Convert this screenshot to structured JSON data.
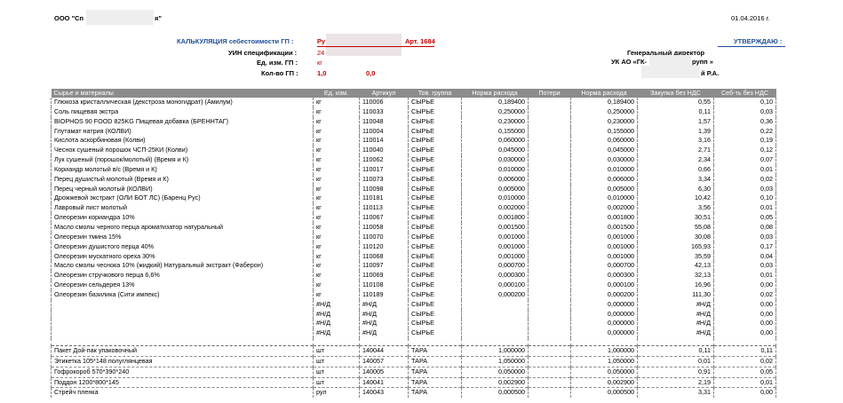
{
  "header": {
    "company": "ООО \"Сп",
    "company_end": "я\"",
    "date": "01.04.2016 г.",
    "calc_label": "КАЛЬКУЛЯЦИЯ себестоимости ГП :",
    "calc_value": "Ру",
    "art": "Арт. 1684",
    "approve": "УТВЕРЖДАЮ :",
    "uin_label": "УИН спецификации :",
    "uin_value": "24",
    "director": "Генеральный директор",
    "unit_label": "Ед. изм. ГП :",
    "unit_value": "кг",
    "uk": "УК АО «ГК-",
    "uk_end": "рупп »",
    "qty_label": "Кол-во ГП :",
    "qty_value": "1,0",
    "qty_value2": "0,0",
    "signer": "й Р.А."
  },
  "table": {
    "columns": [
      "Сырье и материалы",
      "Ед. изм.",
      "Артикул",
      "Тов. группа",
      "Норма расхода",
      "Потери",
      "Норма расхода",
      "Закупка без НДС",
      "Себ-ть без НДС"
    ],
    "rows": [
      [
        "Глюкоза кристаллическая (декстроза моногидрат) (Амилум)",
        "кг",
        "110006",
        "СЫРЬЕ",
        "0,189400",
        "",
        "0,189400",
        "0,55",
        "0,10"
      ],
      [
        "Соль пищевая экстра",
        "кг",
        "110033",
        "СЫРЬЕ",
        "0,250000",
        "",
        "0,250000",
        "0,11",
        "0,03"
      ],
      [
        "BIOPHOS 90 FOOD 825KG Пищевая добавка (БРЕННТАГ)",
        "кг",
        "110048",
        "СЫРЬЕ",
        "0,230000",
        "",
        "0,230000",
        "1,57",
        "0,36"
      ],
      [
        "Глутамат натрия (КОЛВИ)",
        "кг",
        "110004",
        "СЫРЬЕ",
        "0,155000",
        "",
        "0,155000",
        "1,39",
        "0,22"
      ],
      [
        "Кислота аскорбиновая (Колви)",
        "кг",
        "110014",
        "СЫРЬЕ",
        "0,060000",
        "",
        "0,060000",
        "3,16",
        "0,19"
      ],
      [
        "Чеснок сушеный порошок ЧСП-25КИ (Колви)",
        "кг",
        "110040",
        "СЫРЬЕ",
        "0,045000",
        "",
        "0,045000",
        "2,71",
        "0,12"
      ],
      [
        "Лук сушеный (порошок/молотый) (Время и К)",
        "кг",
        "110062",
        "СЫРЬЕ",
        "0,030000",
        "",
        "0,030000",
        "2,34",
        "0,07"
      ],
      [
        "Кориандр молотый в/с (Время и К)",
        "кг",
        "110017",
        "СЫРЬЕ",
        "0,010000",
        "",
        "0,010000",
        "0,66",
        "0,01"
      ],
      [
        "Перец душистый молотый (Время и К)",
        "кг",
        "110073",
        "СЫРЬЕ",
        "0,006000",
        "",
        "0,006000",
        "3,34",
        "0,02"
      ],
      [
        "Перец черный молотый (КОЛВИ)",
        "кг",
        "110098",
        "СЫРЬЕ",
        "0,005000",
        "",
        "0,005000",
        "6,30",
        "0,03"
      ],
      [
        "Дрожжевой экстракт (ОЛИ БОТ ЛС) (Баренц Рус)",
        "кг",
        "110181",
        "СЫРЬЕ",
        "0,010000",
        "",
        "0,010000",
        "10,42",
        "0,10"
      ],
      [
        "Лавровый лист молотый",
        "кг",
        "110113",
        "СЫРЬЕ",
        "0,002000",
        "",
        "0,002000",
        "3,56",
        "0,01"
      ],
      [
        "Олеорезин кориандра 10%",
        "кг",
        "110067",
        "СЫРЬЕ",
        "0,001800",
        "",
        "0,001800",
        "30,51",
        "0,05"
      ],
      [
        "Масло смолы черного перца ароматизатор натуральный",
        "кг",
        "110058",
        "СЫРЬЕ",
        "0,001500",
        "",
        "0,001500",
        "55,08",
        "0,08"
      ],
      [
        "Олеорезин тмина 15%",
        "кг",
        "110070",
        "СЫРЬЕ",
        "0,001000",
        "",
        "0,001000",
        "30,08",
        "0,03"
      ],
      [
        "Олеорезин душистого перца 40%",
        "кг",
        "110120",
        "СЫРЬЕ",
        "0,001000",
        "",
        "0,001000",
        "165,93",
        "0,17"
      ],
      [
        "Олеорезин мускатного ореха 30%",
        "кг",
        "110068",
        "СЫРЬЕ",
        "0,001000",
        "",
        "0,001000",
        "35,59",
        "0,04"
      ],
      [
        "Масло смолы чеснока 10% (жидкий) Натуральный экстракт (Фаберон)",
        "кг",
        "110097",
        "СЫРЬЕ",
        "0,000700",
        "",
        "0,000700",
        "42,13",
        "0,03"
      ],
      [
        "Олеорезин стручкового перца 6,6%",
        "кг",
        "110069",
        "СЫРЬЕ",
        "0,000300",
        "",
        "0,000300",
        "32,13",
        "0,01"
      ],
      [
        "Олеорезин сельдерея 13%",
        "кг",
        "110108",
        "СЫРЬЕ",
        "0,000100",
        "",
        "0,000100",
        "16,96",
        "0,00"
      ],
      [
        "Олеорезин базилика (Сити импекс)",
        "кг",
        "110189",
        "СЫРЬЕ",
        "0,000200",
        "",
        "0,000200",
        "111,30",
        "0,02"
      ],
      [
        "",
        "#Н/Д",
        "#Н/Д",
        "СЫРЬЕ",
        "",
        "",
        "0,000000",
        "#Н/Д",
        "0,00"
      ],
      [
        "",
        "#Н/Д",
        "#Н/Д",
        "СЫРЬЕ",
        "",
        "",
        "0,000000",
        "#Н/Д",
        "0,00"
      ],
      [
        "",
        "#Н/Д",
        "#Н/Д",
        "СЫРЬЕ",
        "",
        "",
        "0,000000",
        "#Н/Д",
        "0,00"
      ],
      [
        "",
        "#Н/Д",
        "#Н/Д",
        "СЫРЬЕ",
        "",
        "",
        "0,000000",
        "#Н/Д",
        "0,00"
      ]
    ],
    "pack_rows": [
      [
        "Пакет Дой-пак упаковочный",
        "шт",
        "140044",
        "ТАРА",
        "1,000000",
        "",
        "1,000000",
        "0,11",
        "0,11"
      ],
      [
        "Этикетка 105*148 полуглянцевая",
        "шт",
        "140057",
        "ТАРА",
        "1,050000",
        "",
        "1,050000",
        "0,01",
        "0,02"
      ],
      [
        "Гофрокороб 570*390*240",
        "шт",
        "140005",
        "ТАРА",
        "0,050000",
        "",
        "0,050000",
        "0,91",
        "0,05"
      ],
      [
        "Поддон 1200*800*145",
        "шт",
        "140041",
        "ТАРА",
        "0,002900",
        "",
        "0,002900",
        "2,19",
        "0,01"
      ],
      [
        "Стрейч пленка",
        "рул",
        "140043",
        "ТАРА",
        "0,000500",
        "",
        "0,000500",
        "3,31",
        "0,00"
      ]
    ]
  }
}
